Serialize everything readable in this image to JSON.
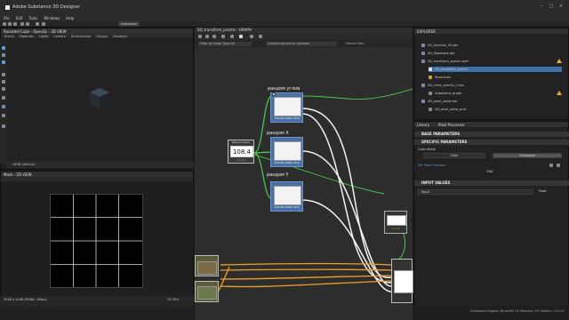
{
  "window": {
    "title": "Adobe Substance 3D Designer"
  },
  "menu": [
    "File",
    "Edit",
    "Tools",
    "Windows",
    "Help"
  ],
  "toolbar": {
    "expression_label": "Expression"
  },
  "view3d": {
    "title": "Rounded Cube - OpenGL - 3D VIEW",
    "menu": [
      "Scene",
      "Materials",
      "Lights",
      "Camera",
      "Environment",
      "Display",
      "Renderer"
    ],
    "footer": "sRGB (default)"
  },
  "view2d": {
    "title": "Mask - 2D VIEW",
    "info": "2048 x 2048 (RGBA, 16bpc)",
    "zoom": "15.39%"
  },
  "graph": {
    "tab_title": "SD_transform_practic - GRAPH",
    "filter_node_type": "Filter by Node Type  All",
    "filter_text": "Containing text or variable",
    "parent_size": "Parent Size:",
    "group_label_angle": "рандом углов",
    "group_label_x": "рандом X",
    "group_label_y": "рандом Y",
    "value_node_value": "108.4",
    "value_node_title": "Value Processor",
    "node_caption": "1.1.1.4",
    "node_size_label": "256x256 (RGBA, 8bit)"
  },
  "explorer": {
    "title": "EXPLORER",
    "items": [
      {
        "label": "SD_function_03.sbs"
      },
      {
        "label": "SD_flowmaps.sbs"
      },
      {
        "label": "SD_transform_practic.sbs*"
      },
      {
        "label": "SD_transform_practic"
      },
      {
        "label": "Resources"
      },
      {
        "label": "SD_circle_practic_2.sbs"
      },
      {
        "label": "Substance_graph"
      },
      {
        "label": "SD_pixel_value.sbs"
      },
      {
        "label": "SD_pixel_value_proc"
      }
    ]
  },
  "properties": {
    "tabs": [
      "Library",
      "Pixel Processor"
    ],
    "base_parameters": "BASE PARAMETERS",
    "specific_parameters": "SPECIFIC PARAMETERS",
    "color_mode_label": "Color Mode",
    "color_mode_options": [
      "Color",
      "Grayscale"
    ],
    "per_pixel_function": "Per Pixel Function",
    "edit_label": "Edit",
    "input_values": "INPUT VALUES",
    "input_name": "Input",
    "input_type": "Float"
  },
  "status": {
    "text": "Substance Engine: Direct3D 11  Memory: 7%    Version: 11.0.3"
  },
  "colors": {
    "node_blue": "#4a6fa5",
    "link_green": "#4ccd4c",
    "link_orange": "#f0a028",
    "accent": "#3d8fd1"
  }
}
